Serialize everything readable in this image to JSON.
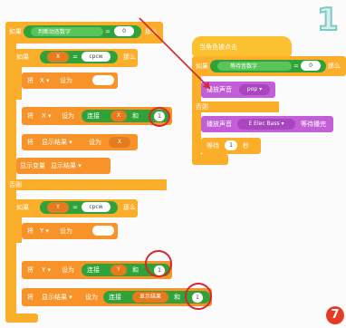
{
  "step_number": "1",
  "badge_number": "7",
  "left_script": {
    "if_label": "如果",
    "then_label": "那么",
    "else_label": "否则",
    "set_label": "将",
    "to_label": "设为",
    "join_label": "连接",
    "and_label": "和",
    "show_variable_label": "显示变量",
    "cond_var": "判断动态数字",
    "eq_value": "0",
    "x_var": "X",
    "y_var": "Y",
    "cpcw": "cpcw",
    "one": "1",
    "display": "显示结果"
  },
  "right_script": {
    "hat_label": "当角色被点击",
    "if_label": "如果",
    "then_label": "那么",
    "cond_var": "等待音数字",
    "eq_value": "0",
    "play_sound_label": "播放声音",
    "sound_pop": "pop",
    "else_label": "否则",
    "sound_elec": "E Elec Bass",
    "wait_until_label": "等待播完",
    "wait_label": "等待",
    "wait_value": "1",
    "seconds_label": "秒"
  }
}
